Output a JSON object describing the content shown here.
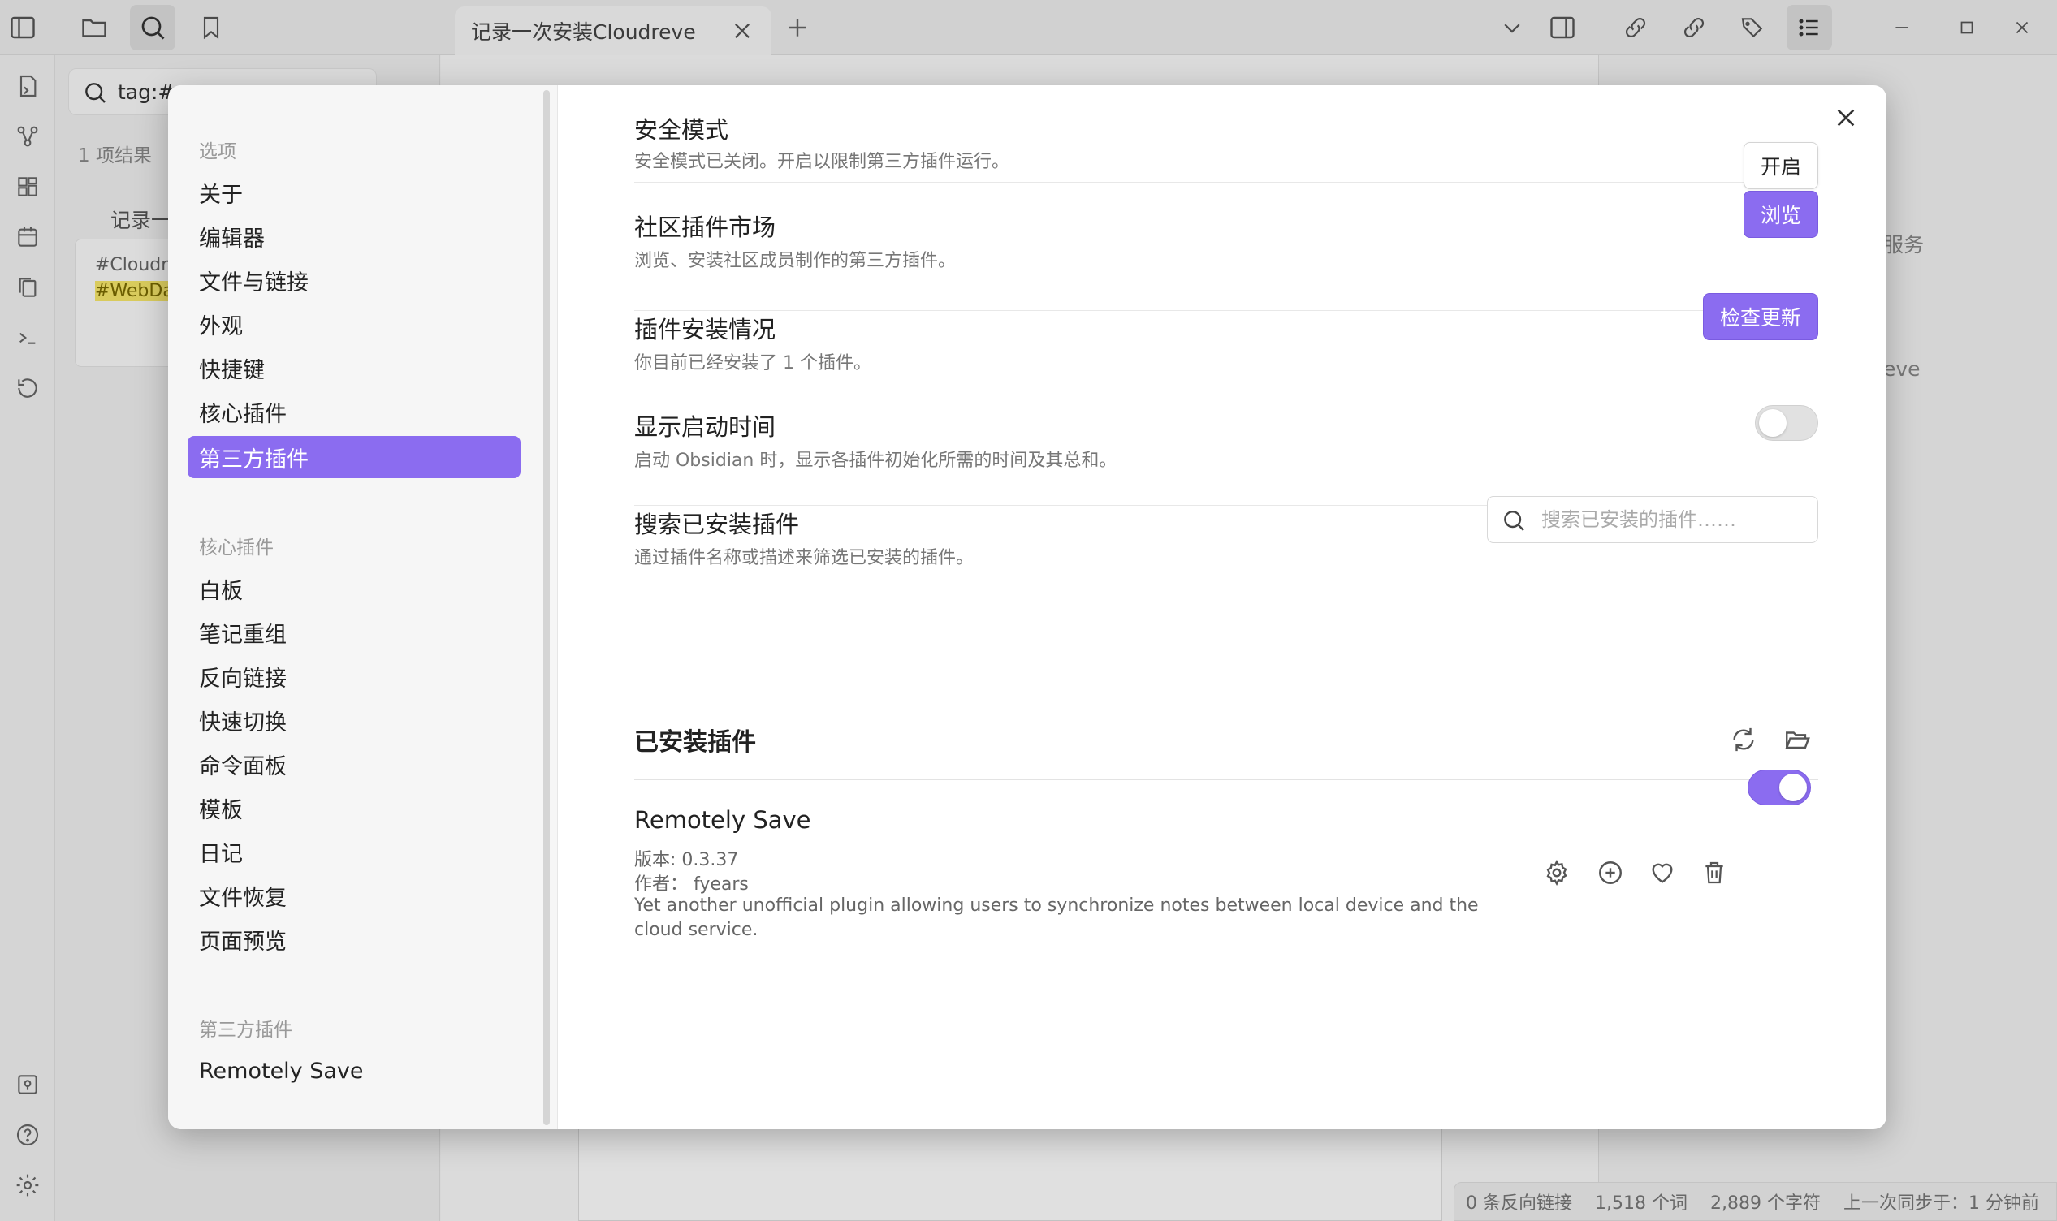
{
  "app": {
    "tab_title": "记录一次安装Cloudreve",
    "search_query": "tag:#",
    "results_count": "1 项结果",
    "result_group": "记录一",
    "result_tags": [
      "#Cloudre",
      "#WebDav"
    ],
    "right_pane_snippets": [
      "服务",
      "eve"
    ],
    "status": {
      "backlinks": "0 条反向链接",
      "words": "1,518 个词",
      "chars": "2,889 个字符",
      "sync": "上一次同步于：1 分钟前"
    }
  },
  "settings_nav": {
    "section_options": "选项",
    "options": [
      "关于",
      "编辑器",
      "文件与链接",
      "外观",
      "快捷键",
      "核心插件",
      "第三方插件"
    ],
    "active_index": 6,
    "section_core": "核心插件",
    "core": [
      "白板",
      "笔记重组",
      "反向链接",
      "快速切换",
      "命令面板",
      "模板",
      "日记",
      "文件恢复",
      "页面预览"
    ],
    "section_third": "第三方插件",
    "third": [
      "Remotely Save"
    ]
  },
  "settings": {
    "safe_mode": {
      "name": "安全模式",
      "desc": "安全模式已关闭。开启以限制第三方插件运行。",
      "button": "开启"
    },
    "community": {
      "name": "社区插件市场",
      "desc": "浏览、安装社区成员制作的第三方插件。",
      "button": "浏览"
    },
    "installed_status": {
      "name": "插件安装情况",
      "desc": "你目前已经安装了 1 个插件。",
      "button": "检查更新"
    },
    "startup_time": {
      "name": "显示启动时间",
      "desc": "启动 Obsidian 时，显示各插件初始化所需的时间及其总和。",
      "enabled": false
    },
    "search_installed": {
      "name": "搜索已安装插件",
      "desc": "通过插件名称或描述来筛选已安装的插件。",
      "placeholder": "搜索已安装的插件……"
    },
    "installed_heading": "已安装插件",
    "plugins": [
      {
        "name": "Remotely Save",
        "version": "版本: 0.3.37",
        "author": "作者：  fyears",
        "desc": "Yet another unofficial plugin allowing users to synchronize notes between local device and the cloud service.",
        "enabled": true
      }
    ]
  },
  "colors": {
    "accent": "#8b6cf0",
    "toggle_off": "#e1e1e1"
  },
  "icons": [
    "sidebar-toggle-icon",
    "folder-icon",
    "search-icon",
    "bookmark-icon",
    "close-icon",
    "plus-icon",
    "chevron-down-icon",
    "reload-icon",
    "folder-open-icon",
    "gear-icon",
    "plus-circle-icon",
    "heart-icon",
    "trash-icon"
  ]
}
